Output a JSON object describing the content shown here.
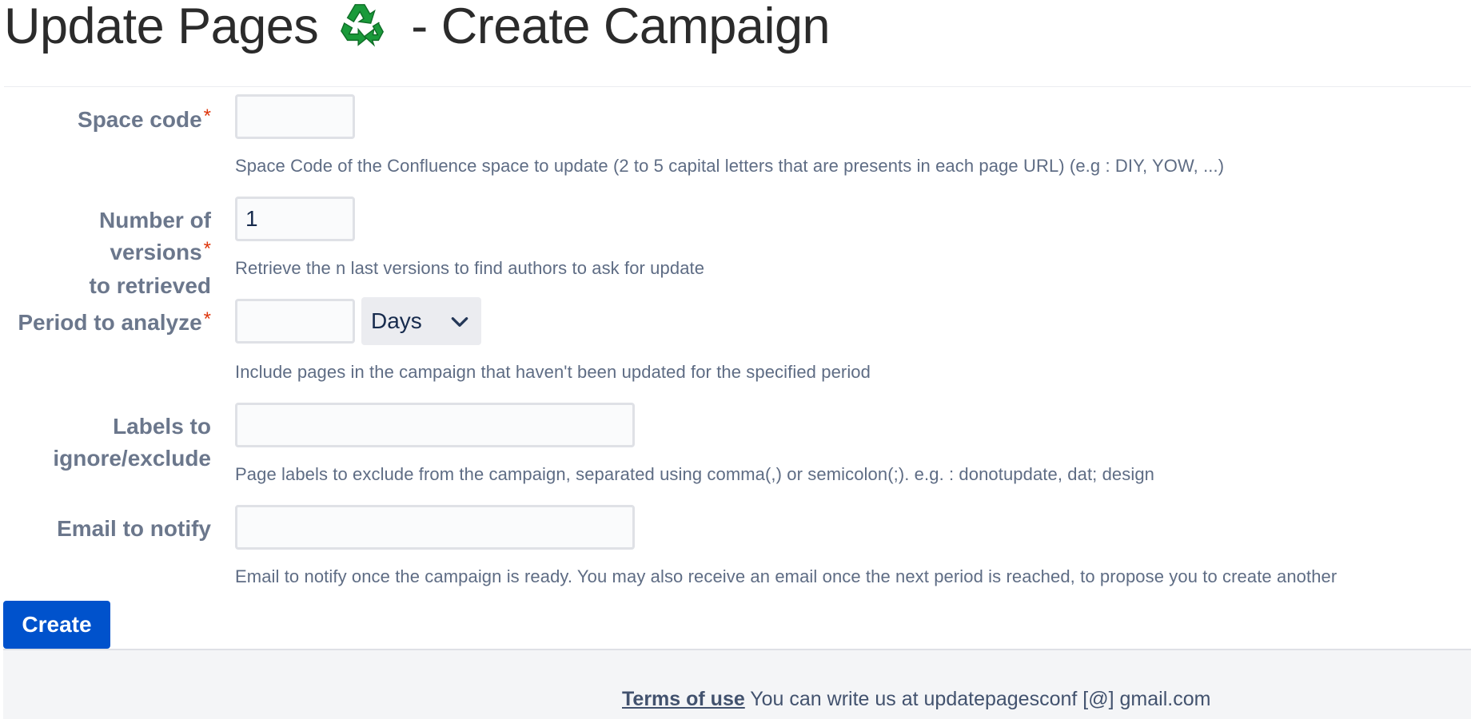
{
  "header": {
    "title_prefix": "Update Pages",
    "title_suffix": "- Create Campaign",
    "icon": "recycle-icon"
  },
  "form": {
    "space_code": {
      "label": "Space code",
      "required_mark": "*",
      "value": "",
      "help": "Space Code of the Confluence space to update (2 to 5 capital letters that are presents in each page URL) (e.g : DIY, YOW, ...)"
    },
    "versions": {
      "label_line1": "Number of versions",
      "label_line2": "to retrieved",
      "required_mark": "*",
      "value": "1",
      "help": "Retrieve the n last versions to find authors to ask for update"
    },
    "period": {
      "label": "Period to analyze",
      "required_mark": "*",
      "value": "",
      "unit_selected": "Days",
      "help": "Include pages in the campaign that haven't been updated for the specified period"
    },
    "labels": {
      "label_line1": "Labels to",
      "label_line2": "ignore/exclude",
      "value": "",
      "help": "Page labels to exclude from the campaign, separated using comma(,) or semicolon(;). e.g. : donotupdate, dat; design"
    },
    "email": {
      "label": "Email to notify",
      "value": "",
      "help": "Email to notify once the campaign is ready. You may also receive an email once the next period is reached, to propose you to create another"
    },
    "submit_label": "Create"
  },
  "footer": {
    "terms_label": "Terms of use",
    "contact_text": "You can write us at updatepagesconf [@] gmail.com"
  },
  "colors": {
    "primary": "#0052cc",
    "required": "#de350b",
    "label": "#6b778c",
    "help": "#5e6c84"
  }
}
